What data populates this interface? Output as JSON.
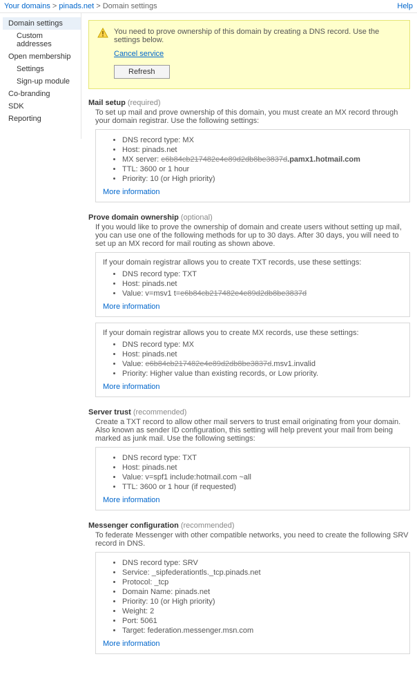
{
  "topbar": {
    "root": "Your domains",
    "domain": "pinads.net",
    "page": "Domain settings",
    "help": "Help"
  },
  "sidebar": {
    "items": [
      {
        "label": "Domain settings",
        "selected": true,
        "children": [
          {
            "label": "Custom addresses"
          }
        ]
      },
      {
        "label": "Open membership",
        "children": [
          {
            "label": "Settings"
          },
          {
            "label": "Sign-up module"
          }
        ]
      },
      {
        "label": "Co-branding"
      },
      {
        "label": "SDK"
      },
      {
        "label": "Reporting"
      }
    ]
  },
  "notice": {
    "message": "You need to prove ownership of this domain by creating a DNS record. Use the settings below.",
    "cancel": "Cancel service",
    "refresh": "Refresh"
  },
  "more_info": "More information",
  "mail": {
    "title": "Mail setup",
    "note": "(required)",
    "intro": "To set up mail and prove ownership of this domain, you must create an MX record through your domain registrar. Use the following settings:",
    "li1": "DNS record type: MX",
    "li2": "Host: pinads.net",
    "li3_pre": "MX server: ",
    "li3_red": "e6b84cb217482e4e89d2db8be3837d",
    "li3_post": ".pamx1.hotmail.com",
    "li4": "TTL: 3600 or 1 hour",
    "li5": "Priority: 10 (or High priority)"
  },
  "prove": {
    "title": "Prove domain ownership",
    "note": "(optional)",
    "intro": "If you would like to prove the ownership of domain and create users without setting up mail, you can use one of the following methods for up to 30 days. After 30 days, you will need to set up an MX record for mail routing as shown above.",
    "txt_lead": "If your domain registrar allows you to create TXT records, use these settings:",
    "txt_li1": "DNS record type: TXT",
    "txt_li2": "Host: pinads.net",
    "txt_li3_pre": "Value: v=msv1 t=",
    "txt_li3_red": "e6b84cb217482e4e89d2db8be3837d",
    "mx_lead": "If your domain registrar allows you to create MX records, use these settings:",
    "mx_li1": "DNS record type: MX",
    "mx_li2": "Host: pinads.net",
    "mx_li3_pre": "Value: ",
    "mx_li3_red": "e6b84cb217482e4e89d2db8be3837d",
    "mx_li3_post": ".msv1.invalid",
    "mx_li4": "Priority: Higher value than existing records, or Low priority."
  },
  "trust": {
    "title": "Server trust",
    "note": "(recommended)",
    "intro": "Create a TXT record to allow other mail servers to trust email originating from your domain. Also known as sender ID configuration, this setting will help prevent your mail from being marked as junk mail. Use the following settings:",
    "li1": "DNS record type: TXT",
    "li2": "Host: pinads.net",
    "li3": "Value: v=spf1 include:hotmail.com ~all",
    "li4": "TTL: 3600 or 1 hour (if requested)"
  },
  "msgr": {
    "title": "Messenger configuration",
    "note": "(recommended)",
    "intro": "To federate Messenger with other compatible networks, you need to create the following SRV record in DNS.",
    "li1": "DNS record type: SRV",
    "li2": "Service: _sipfederationtls._tcp.pinads.net",
    "li3": "Protocol: _tcp",
    "li4": "Domain Name: pinads.net",
    "li5": "Priority: 10 (or High priority)",
    "li6": "Weight: 2",
    "li7": "Port: 5061",
    "li8": "Target: federation.messenger.msn.com"
  }
}
